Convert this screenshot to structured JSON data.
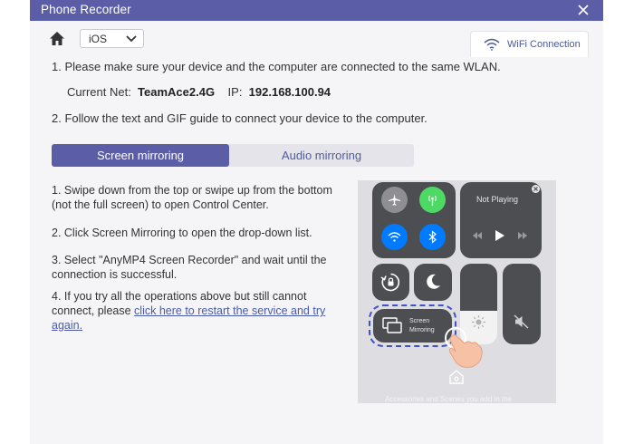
{
  "window": {
    "title": "Phone Recorder"
  },
  "toolbar": {
    "os_value": "iOS",
    "wifi_tab_label": "WiFi Connection"
  },
  "content": {
    "step1": "1. Please make sure your device and the computer are connected to the same WLAN.",
    "current_net_label": "Current Net:",
    "current_net_value": "TeamAce2.4G",
    "ip_label": "IP:",
    "ip_value": "192.168.100.94",
    "step2": "2. Follow the text and GIF guide to connect your device to the computer."
  },
  "tabs": {
    "screen_mirroring": "Screen mirroring",
    "audio_mirroring": "Audio mirroring"
  },
  "instructions": {
    "i1": "1. Swipe down from the top or swipe up from the bottom (not the full screen) to open Control Center.",
    "i2": "2. Click Screen Mirroring to open the drop-down list.",
    "i3": "3. Select \"AnyMP4 Screen Recorder\" and wait until the connection is successful.",
    "i4_prefix": "4. If you try all the operations above but still cannot connect, please ",
    "i4_link": "click here to restart the service and try again."
  },
  "control_center": {
    "not_playing": "Not Playing",
    "screen_mirroring_line1": "Screen",
    "screen_mirroring_line2": "Mirroring",
    "accessories_text": "Accessories and Scenes you add in the"
  },
  "colors": {
    "accent": "#5b5ea6",
    "link": "#4a5aaa",
    "airplane_bg": "#8e8e93",
    "cellular_bg": "#4cd964",
    "wifi_bg": "#007aff",
    "bluetooth_bg": "#007aff"
  }
}
